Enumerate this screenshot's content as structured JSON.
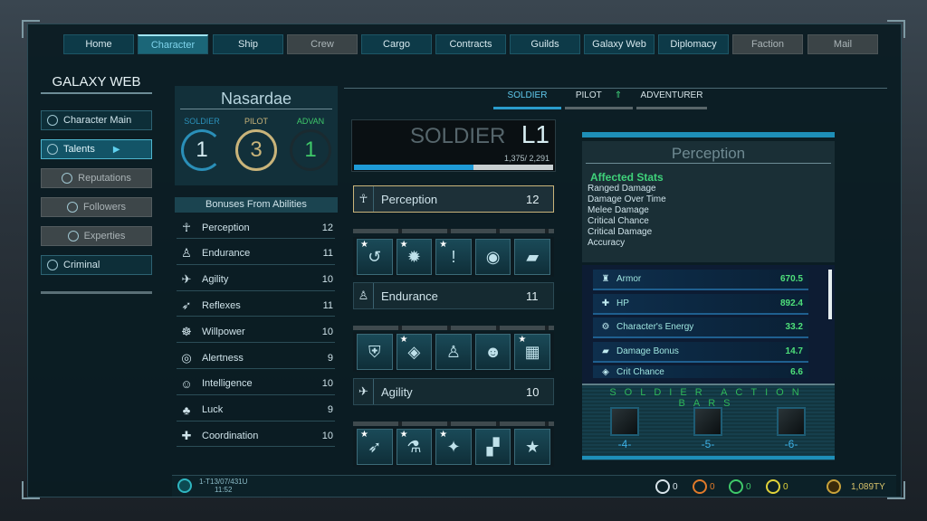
{
  "nav": [
    {
      "label": "Home",
      "state": "normal"
    },
    {
      "label": "Character",
      "state": "active"
    },
    {
      "label": "Ship",
      "state": "normal"
    },
    {
      "label": "Crew",
      "state": "disabled"
    },
    {
      "label": "Cargo",
      "state": "normal"
    },
    {
      "label": "Contracts",
      "state": "normal"
    },
    {
      "label": "Guilds",
      "state": "normal"
    },
    {
      "label": "Galaxy Web",
      "state": "normal"
    },
    {
      "label": "Diplomacy",
      "state": "normal"
    },
    {
      "label": "Faction",
      "state": "disabled"
    },
    {
      "label": "Mail",
      "state": "disabled"
    }
  ],
  "sidebar": {
    "title": "GALAXY WEB",
    "items": [
      {
        "label": "Character Main",
        "icon": "person-icon"
      },
      {
        "label": "Talents",
        "icon": "talents-icon"
      },
      {
        "label": "Reputations",
        "icon": "reputation-icon"
      },
      {
        "label": "Followers",
        "icon": "followers-icon"
      },
      {
        "label": "Experties",
        "icon": "experties-icon"
      },
      {
        "label": "Criminal",
        "icon": "criminal-icon"
      }
    ]
  },
  "character": {
    "name": "Nasardae",
    "classes": [
      {
        "label": "SOLDIER",
        "level": "1",
        "color": "#2a8fb8"
      },
      {
        "label": "PILOT",
        "level": "3",
        "color": "#c9b47a"
      },
      {
        "label": "ADVAN",
        "level": "1",
        "color": "#3fc96a"
      }
    ],
    "bonuses_title": "Bonuses From Abilities",
    "stats": [
      {
        "name": "Perception",
        "value": "12"
      },
      {
        "name": "Endurance",
        "value": "11"
      },
      {
        "name": "Agility",
        "value": "10"
      },
      {
        "name": "Reflexes",
        "value": "11"
      },
      {
        "name": "Willpower",
        "value": "10"
      },
      {
        "name": "Alertness",
        "value": "9"
      },
      {
        "name": "Intelligence",
        "value": "10"
      },
      {
        "name": "Luck",
        "value": "9"
      },
      {
        "name": "Coordination",
        "value": "10"
      }
    ]
  },
  "tabs": [
    {
      "label": "SOLDIER",
      "active": true
    },
    {
      "label": "PILOT",
      "active": false
    },
    {
      "label": "ADVENTURER",
      "active": false
    }
  ],
  "talent": {
    "class": "SOLDIER",
    "level": "L1",
    "xp": "1,375/ 2,291",
    "xp_fraction": 0.6,
    "rows": [
      {
        "name": "Perception",
        "value": "12",
        "selected": true
      },
      {
        "name": "Endurance",
        "value": "11"
      },
      {
        "name": "Agility",
        "value": "10"
      }
    ]
  },
  "detail": {
    "title": "Perception",
    "affected_title": "Affected Stats",
    "affected": [
      "Ranged Damage",
      "Damage Over Time",
      "Melee Damage",
      "Critical Chance",
      "Critical Damage",
      "Accuracy"
    ],
    "char_stats": [
      {
        "name": "Armor",
        "value": "670.5"
      },
      {
        "name": "HP",
        "value": "892.4"
      },
      {
        "name": "Character's Energy",
        "value": "33.2"
      },
      {
        "name": "Damage Bonus",
        "value": "14.7"
      },
      {
        "name": "Crit Chance",
        "value": "6.6"
      }
    ],
    "action_title": "SOLDIER ACTION BARS",
    "action_bars": [
      "-4-",
      "-5-",
      "-6-"
    ]
  },
  "footer": {
    "date": "1-T13/07/431U",
    "time": "11:52",
    "currencies": [
      {
        "value": "0",
        "color": "#d8e4ea"
      },
      {
        "value": "0",
        "color": "#e07a2a"
      },
      {
        "value": "0",
        "color": "#3fc96a"
      },
      {
        "value": "0",
        "color": "#e0d23a"
      }
    ],
    "money": "1,089TY"
  }
}
